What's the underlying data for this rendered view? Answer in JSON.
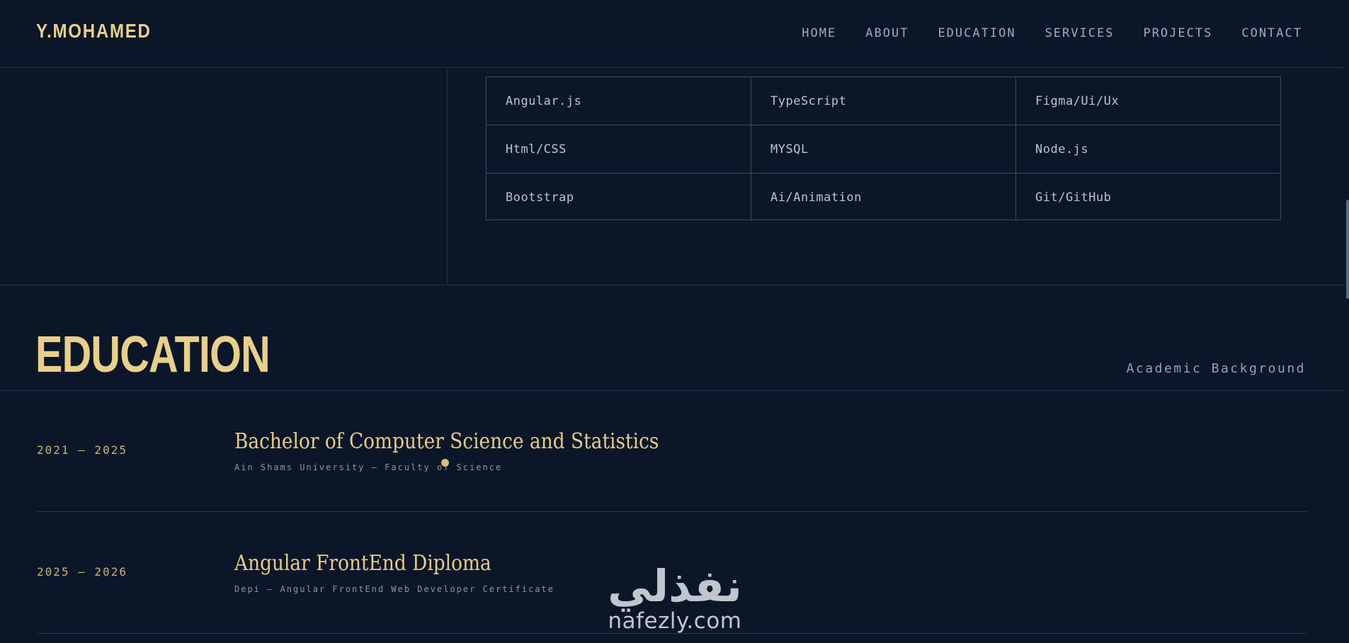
{
  "header": {
    "logo": "Y.MOHAMED",
    "nav": [
      "HOME",
      "ABOUT",
      "EDUCATION",
      "SERVICES",
      "PROJECTS",
      "CONTACT"
    ]
  },
  "skills": {
    "rows": [
      [
        "Angular.js",
        "TypeScript",
        "Figma/Ui/Ux"
      ],
      [
        "Html/CSS",
        "MYSQL",
        "Node.js"
      ],
      [
        "Bootstrap",
        "Ai/Animation",
        "Git/GitHub"
      ]
    ]
  },
  "education": {
    "title": "EDUCATION",
    "subtitle": "Academic Background",
    "entries": [
      {
        "years": "2021 — 2025",
        "degree": "Bachelor of Computer Science and Statistics",
        "institution": "Ain Shams University — Faculty of Science"
      },
      {
        "years": "2025 — 2026",
        "degree": "Angular FrontEnd Diploma",
        "institution": "Depi — Angular FrontEnd Web Developer Certificate"
      }
    ]
  },
  "watermark": {
    "arabic": "نفذلي",
    "latin": "nafezly.com"
  },
  "colors": {
    "background": "#0b1729",
    "accent": "#e8cf8a",
    "muted_text": "#9aaac2"
  }
}
